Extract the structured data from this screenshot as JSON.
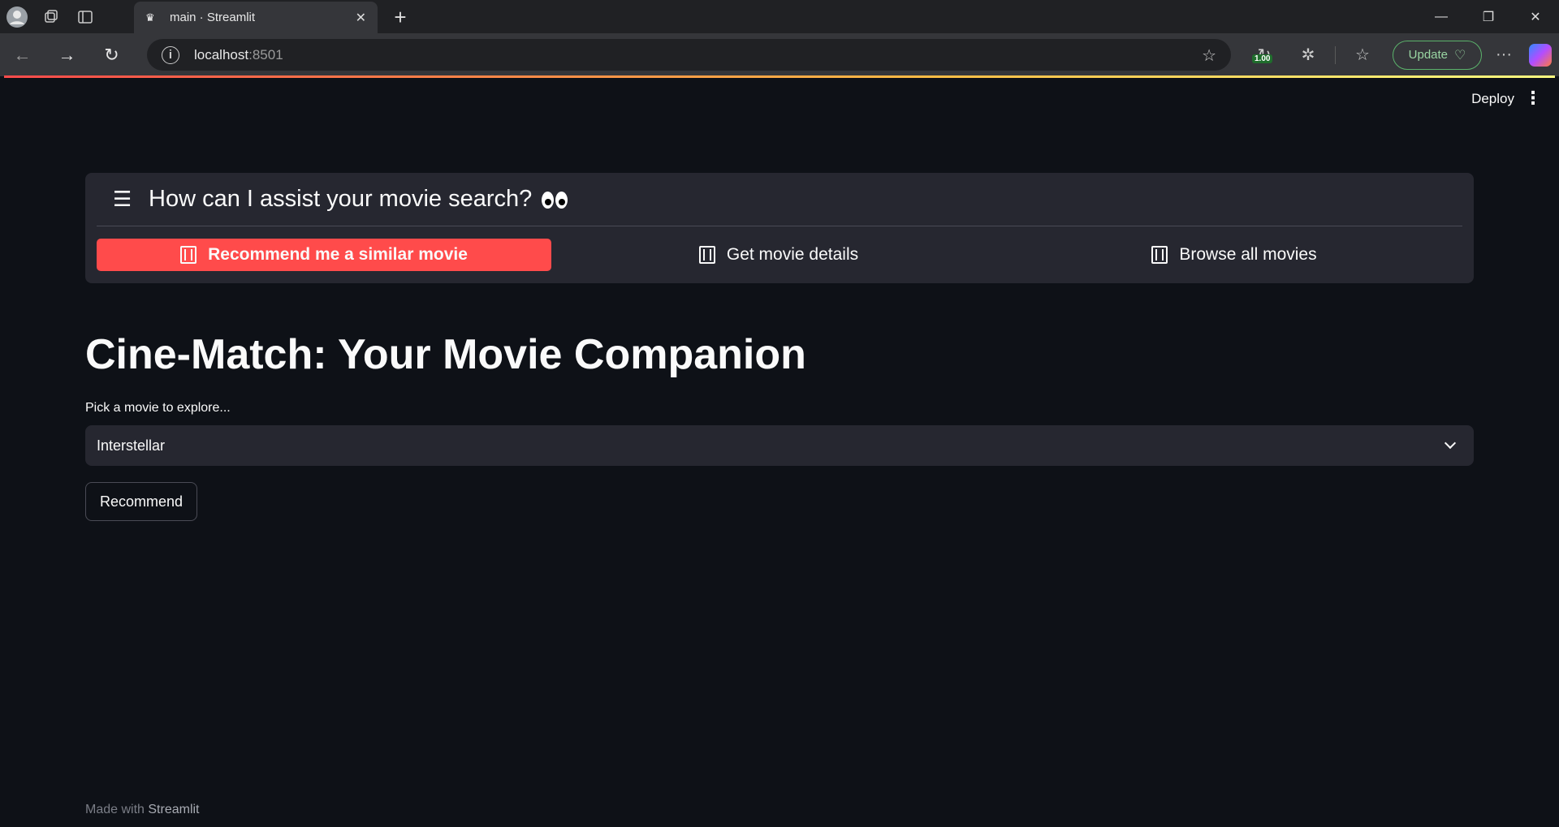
{
  "browser": {
    "tab_title": "main · Streamlit",
    "url_host": "localhost",
    "url_port": ":8501",
    "extension_badge": "1.00",
    "update_label": "Update"
  },
  "header": {
    "deploy_label": "Deploy"
  },
  "option_menu": {
    "title": "How can I assist your movie search?",
    "items": [
      {
        "label": "Recommend me a similar movie",
        "active": true
      },
      {
        "label": "Get movie details",
        "active": false
      },
      {
        "label": "Browse all movies",
        "active": false
      }
    ],
    "active_color": "#ff4b4b"
  },
  "main": {
    "title": "Cine-Match: Your Movie Companion",
    "select_label": "Pick a movie to explore...",
    "selected_movie": "Interstellar",
    "recommend_label": "Recommend"
  },
  "footer": {
    "prefix": "Made with",
    "brand": "Streamlit"
  },
  "icons": {
    "menu": "hamburger-icon",
    "menu_item": "film-icon",
    "emoji": "eyes-emoji"
  }
}
